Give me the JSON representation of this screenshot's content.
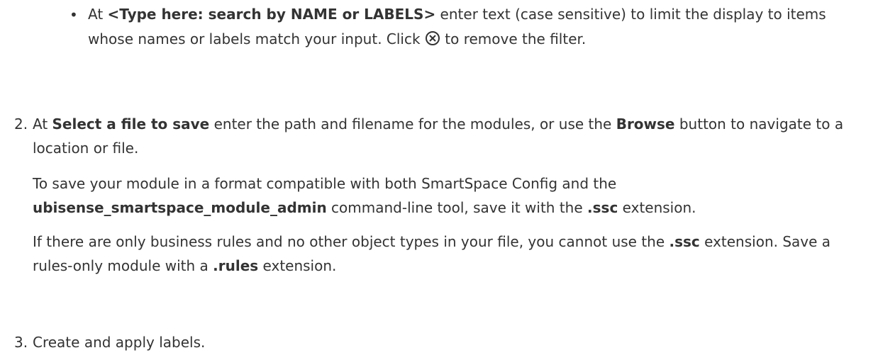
{
  "bullet": {
    "text_at": "At ",
    "lt": "<",
    "search_label": "Type here: search by NAME or LABELS",
    "gt": ">",
    "text_mid": " enter text (case sensitive) to limit the display to items whose names or labels match your input. Click ",
    "icon": "circle-x-icon",
    "text_end": " to remove the filter."
  },
  "steps": [
    {
      "number": "2.",
      "p1_a": "At ",
      "p1_b": "Select a file to save",
      "p1_c": " enter the path and filename for the modules, or use the ",
      "p1_d": "Browse",
      "p1_e": " button to navigate to a location or file.",
      "p2_a": "To save your module in a format compatible with both SmartSpace Config and the ",
      "p2_b": "ubisense_smartspace_module_admin",
      "p2_c": " command-line tool, save it with the ",
      "p2_d": ".ssc",
      "p2_e": " extension.",
      "p3_a": "If there are only business rules and no other object types in your file, you cannot use the ",
      "p3_b": ".ssc",
      "p3_c": " extension. Save a rules-only module with a ",
      "p3_d": ".rules",
      "p3_e": " extension."
    },
    {
      "number": "3.",
      "p1": "Create and apply labels."
    }
  ]
}
